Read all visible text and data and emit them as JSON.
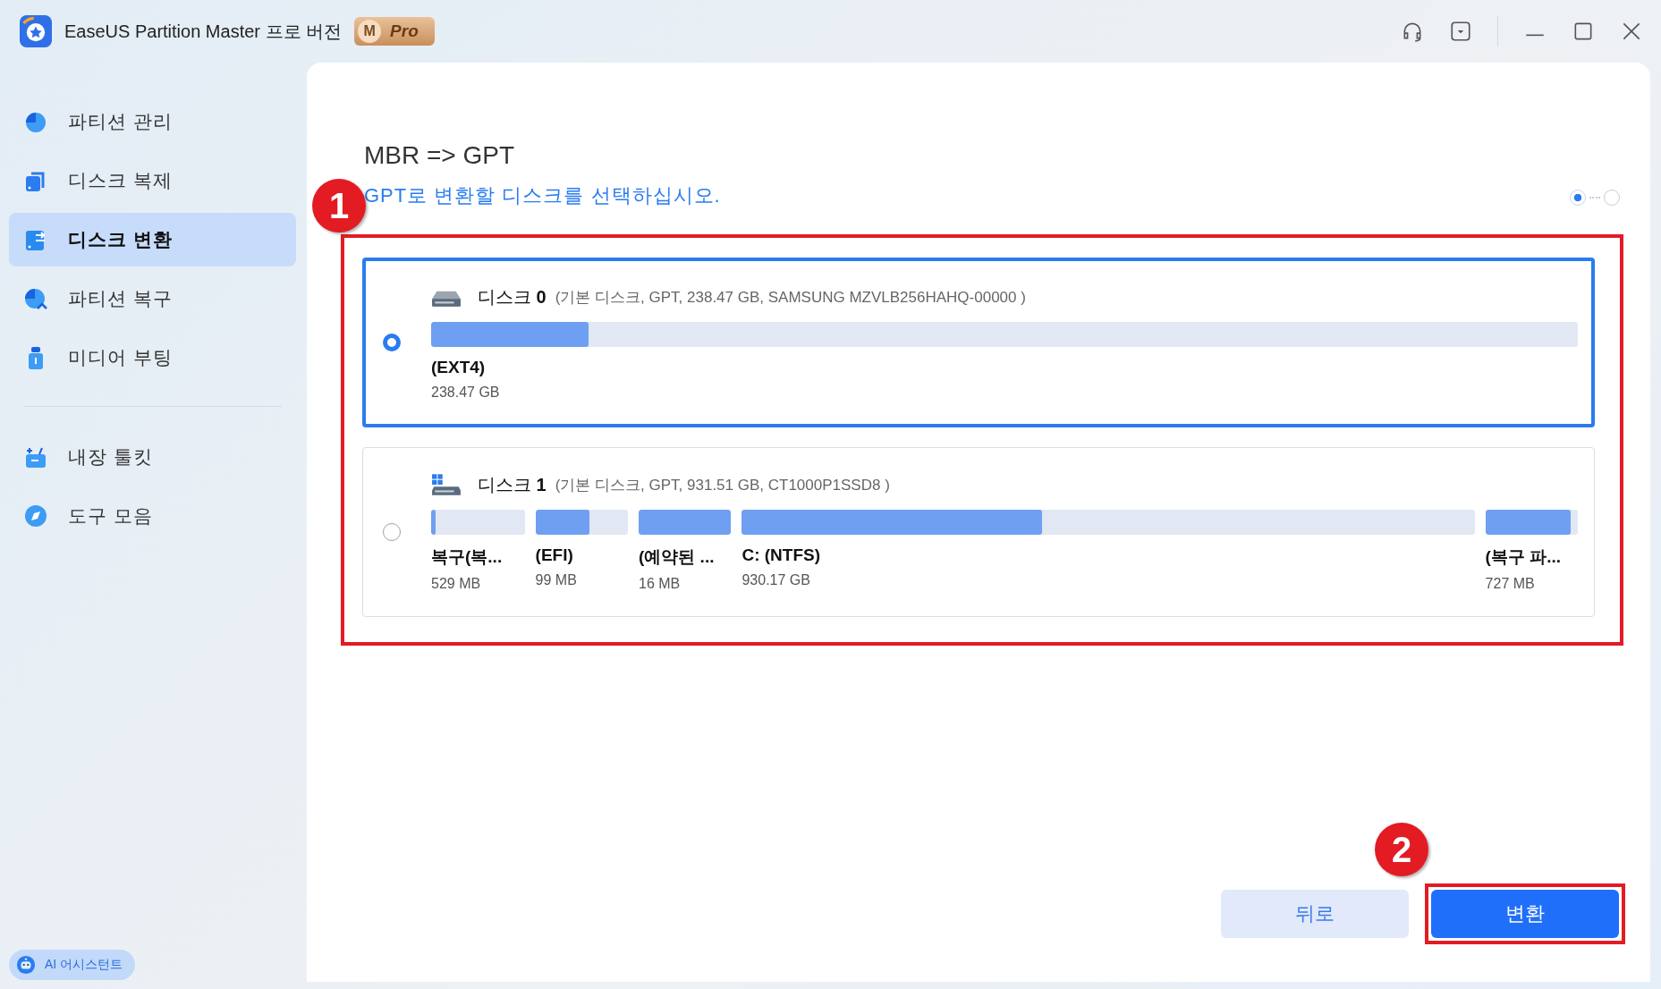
{
  "window": {
    "title": "EaseUS Partition Master 프로 버전",
    "badge": {
      "letter": "M",
      "text": "Pro"
    }
  },
  "sidebar": {
    "items": [
      {
        "label": "파티션 관리",
        "selected": false
      },
      {
        "label": "디스크 복제",
        "selected": false
      },
      {
        "label": "디스크 변환",
        "selected": true
      },
      {
        "label": "파티션 복구",
        "selected": false
      },
      {
        "label": "미디어 부팅",
        "selected": false
      },
      {
        "label": "내장 툴킷",
        "selected": false
      },
      {
        "label": "도구 모음",
        "selected": false
      }
    ],
    "assistant": "AI 어시스턴트"
  },
  "main": {
    "title": "MBR => GPT",
    "subtitle": "GPT로 변환할 디스크를 선택하십시오.",
    "steps": [
      {
        "selected": true
      },
      {
        "selected": false
      }
    ],
    "disks": [
      {
        "name": "디스크 **0**",
        "details": "(기본 디스크, GPT, 238.47 GB, SAMSUNG MZVLB256HAHQ-00000 )",
        "selected": true,
        "partitions": [
          {
            "name": "(EXT4)",
            "size": "238.47 GB",
            "level": 0.137
          }
        ]
      },
      {
        "name": "디스크 **1**",
        "details": "(기본 디스크, GPT, 931.51 GB, CT1000P1SSD8 )",
        "selected": false,
        "partitions": [
          {
            "name": "복구(복...",
            "size": "529 MB",
            "level": 0.05
          },
          {
            "name": "(EFI)",
            "size": "99 MB",
            "level": 0.58
          },
          {
            "name": "(예약된 ...",
            "size": "16 MB",
            "level": 1
          },
          {
            "name": "C: (NTFS)",
            "size": "930.17 GB",
            "level": 0.41
          },
          {
            "name": "(복구 파...",
            "size": "727 MB",
            "level": 0.92
          }
        ]
      }
    ],
    "buttons": [
      {
        "label": "뒤로",
        "kind": "secondary"
      },
      {
        "label": "변환",
        "kind": "primary"
      }
    ],
    "annotations": [
      {
        "label": "1"
      },
      {
        "label": "2"
      }
    ]
  }
}
